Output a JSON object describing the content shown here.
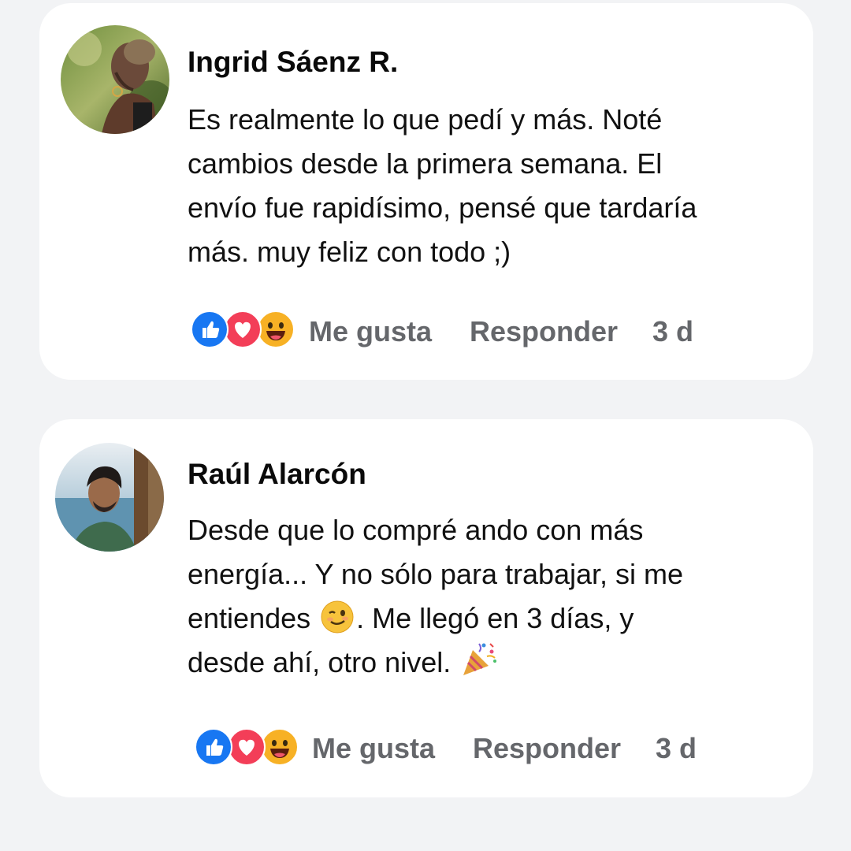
{
  "comments": [
    {
      "author": "Ingrid Sáenz R.",
      "lines": [
        "Es realmente lo que pedí y más. Noté",
        "cambios desde la primera semana. El",
        "envío fue rapidísimo, pensé que tardaría",
        "más. muy feliz con todo ;)"
      ],
      "reactions": [
        "like-icon",
        "love-icon",
        "haha-icon"
      ],
      "like_label": "Me gusta",
      "reply_label": "Responder",
      "time": "3 d"
    },
    {
      "author": "Raúl Alarcón",
      "line_1": "Desde que lo compré ando con más",
      "line_2": "energía... Y no sólo para trabajar, si me",
      "line_3_before": "entiendes ",
      "line_3_emoji": "winking-face-emoji",
      "line_3_after": ". Me llegó en 3 días, y",
      "line_4_before": "desde ahí, otro nivel. ",
      "line_4_emoji": "party-popper-emoji",
      "reactions": [
        "like-icon",
        "love-icon",
        "haha-icon"
      ],
      "like_label": "Me gusta",
      "reply_label": "Responder",
      "time": "3 d"
    }
  ],
  "colors": {
    "like": "#1877f2",
    "love": "#f33e58",
    "haha": "#f7b125",
    "meta_text": "#65676b",
    "name_text": "#0a0a0a"
  }
}
